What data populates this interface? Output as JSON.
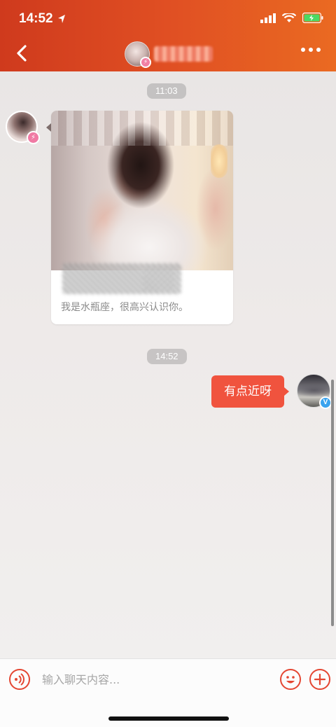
{
  "status_bar": {
    "time": "14:52"
  },
  "header": {
    "accent_color": "#dd4a20"
  },
  "messages": [
    {
      "type": "time",
      "text": "11:03"
    },
    {
      "type": "card",
      "side": "left",
      "caption": "我是水瓶座，很高兴认识你。"
    },
    {
      "type": "time",
      "text": "14:52"
    },
    {
      "type": "text",
      "side": "right",
      "text": "有点近呀"
    }
  ],
  "badges": {
    "verified": "V"
  },
  "input_bar": {
    "placeholder": "输入聊天内容..."
  },
  "icons": [
    "back-icon",
    "more-icon",
    "voice-icon",
    "emoji-icon",
    "plus-icon",
    "signal-icon",
    "wifi-icon",
    "battery-icon",
    "location-arrow-icon"
  ],
  "colors": {
    "bubble_right": "#f0533e",
    "icon_accent": "#e44632"
  }
}
